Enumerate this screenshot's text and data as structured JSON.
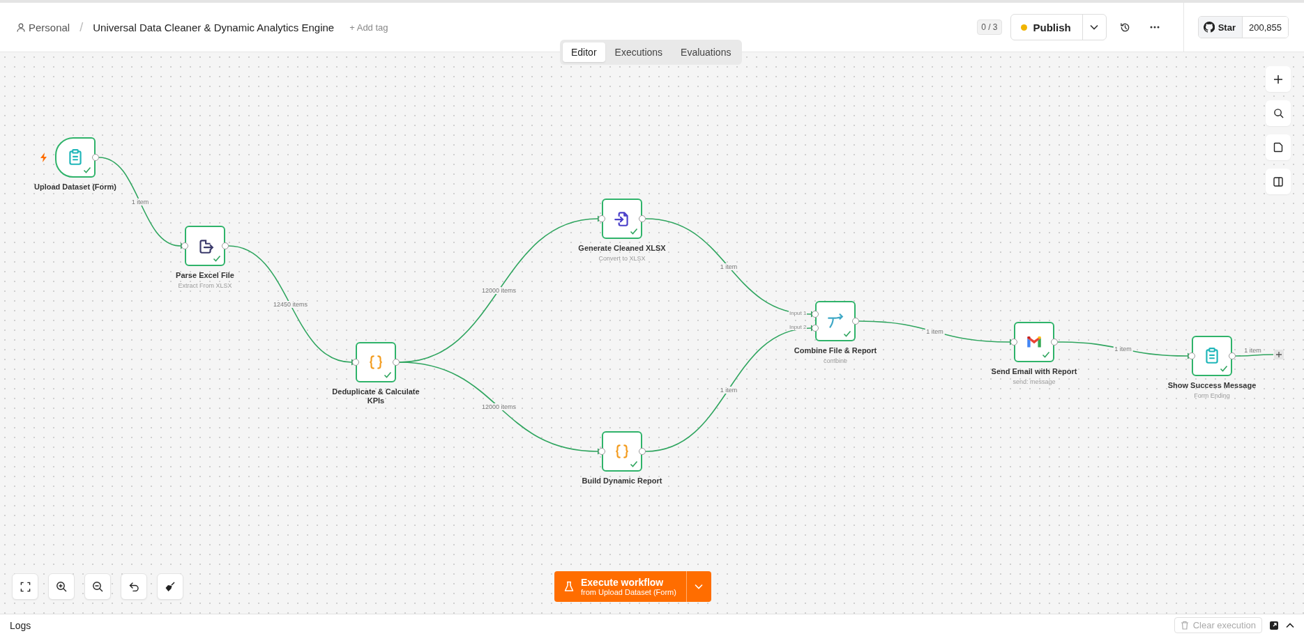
{
  "header": {
    "project": "Personal",
    "separator": "/",
    "title": "Universal Data Cleaner & Dynamic Analytics Engine",
    "add_tag": "+ Add tag",
    "counter": "0 / 3",
    "publish": "Publish",
    "github": {
      "label": "Star",
      "count": "200,855"
    }
  },
  "tabs": [
    {
      "label": "Editor",
      "selected": true
    },
    {
      "label": "Executions",
      "selected": false
    },
    {
      "label": "Evaluations",
      "selected": false
    }
  ],
  "nodes": [
    {
      "kind": "trigger",
      "label": "Upload Dataset (Form)",
      "success": true
    },
    {
      "kind": "action",
      "label": "Parse Excel File",
      "subtitle": "Extract From XLSX",
      "success": true
    },
    {
      "kind": "action",
      "label": "Deduplicate & Calculate KPIs",
      "success": true
    },
    {
      "kind": "action",
      "label": "Generate Cleaned XLSX",
      "subtitle": "Convert to XLSX",
      "success": true
    },
    {
      "kind": "action",
      "label": "Build Dynamic Report",
      "success": true
    },
    {
      "kind": "action",
      "label": "Combine File & Report",
      "subtitle": "combine",
      "success": true,
      "inputs": [
        "Input 1",
        "Input 2"
      ]
    },
    {
      "kind": "action",
      "label": "Send Email with Report",
      "subtitle": "send: message",
      "success": true
    },
    {
      "kind": "action",
      "label": "Show Success Message",
      "subtitle": "Form Ending",
      "success": true
    }
  ],
  "edges": [
    {
      "label": "1 item"
    },
    {
      "label": "12450 items"
    },
    {
      "label": "12000 items"
    },
    {
      "label": "12000 items"
    },
    {
      "label": "1 item"
    },
    {
      "label": "1 item"
    },
    {
      "label": "1 item"
    },
    {
      "label": "1 item"
    },
    {
      "label": "1 item"
    }
  ],
  "execute": {
    "label": "Execute workflow",
    "sublabel": "from Upload Dataset (Form)"
  },
  "logs": {
    "title": "Logs",
    "clear": {
      "label": "Clear execution",
      "disabled": true
    }
  }
}
